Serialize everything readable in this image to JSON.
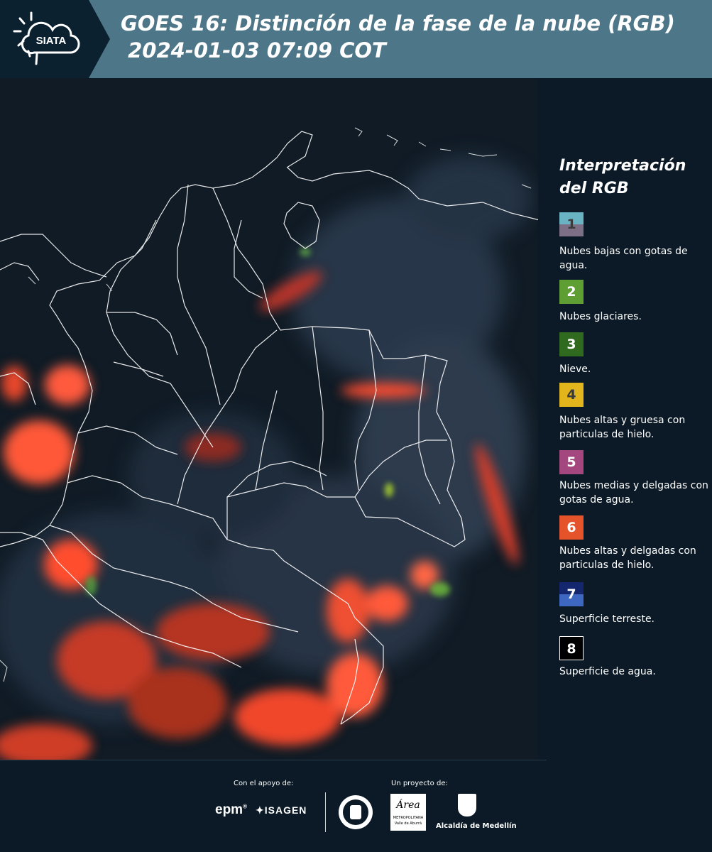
{
  "header": {
    "logo_text": "SIATA",
    "title_line1": "GOES 16: Distinción de la fase de la nube (RGB)",
    "title_line2": " 2024-01-03 07:09 COT",
    "background_color": "#4d7688"
  },
  "legend": {
    "title": "Interpretación del RGB",
    "items": [
      {
        "number": "1",
        "label": "Nubes bajas con gotas de agua.",
        "color_top": "#6ab3c3",
        "color_bottom": "#7c6f86"
      },
      {
        "number": "2",
        "label": "Nubes glaciares.",
        "color_top": "#5f9e32",
        "color_bottom": "#5f9e32"
      },
      {
        "number": "3",
        "label": "Nieve.",
        "color_top": "#2f6a1e",
        "color_bottom": "#2f6a1e"
      },
      {
        "number": "4",
        "label": "Nubes altas y gruesa con particulas de hielo.",
        "color_top": "#e2b51d",
        "color_bottom": "#e2b51d"
      },
      {
        "number": "5",
        "label": "Nubes medias y delgadas con gotas de agua.",
        "color_top": "#a3477e",
        "color_bottom": "#a3477e"
      },
      {
        "number": "6",
        "label": "Nubes altas y delgadas con particulas de hielo.",
        "color_top": "#e5532a",
        "color_bottom": "#e5532a"
      },
      {
        "number": "7",
        "label": "Superficie terreste.",
        "color_top": "#14266e",
        "color_bottom": "#3e67c2"
      },
      {
        "number": "8",
        "label": "Superficie de agua.",
        "color_top": "#000000",
        "color_bottom": "#000000"
      }
    ]
  },
  "footer": {
    "support_label": "Con el apoyo de:",
    "project_label": "Un proyecto de:",
    "sponsor_epm": "epm",
    "sponsor_isagen": "ISAGEN",
    "area_metro_text": "Área",
    "area_metro_sub": "METROPOLITANA",
    "area_metro_sub2": "Valle de Aburrá",
    "alcaldia": "Alcaldía de Medellín"
  }
}
